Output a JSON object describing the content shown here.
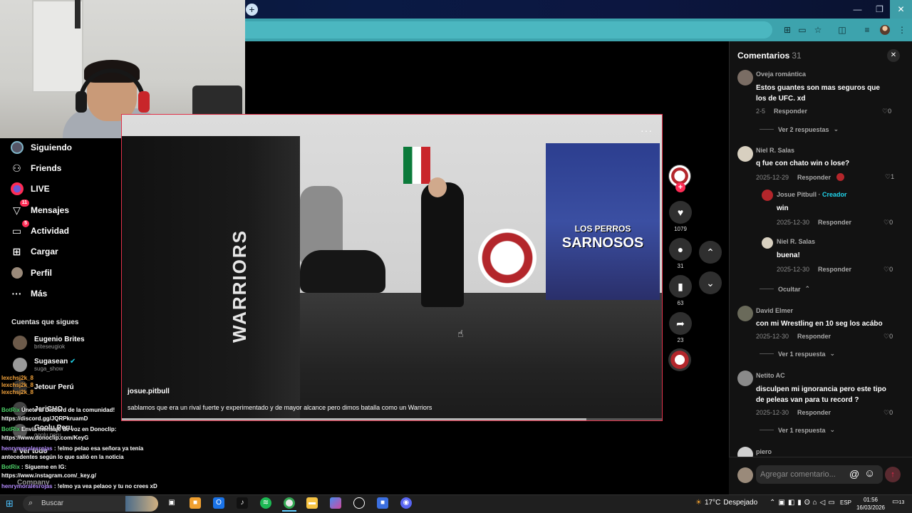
{
  "browser": {
    "new_tab": "+",
    "window_buttons": [
      "—",
      "❐",
      "✕"
    ],
    "toolbar_icons": [
      "translate-icon",
      "cast-icon",
      "star-icon",
      "extensions-icon",
      "playlist-icon",
      "menu-icon"
    ]
  },
  "nav": {
    "items": [
      {
        "label": "Siguiendo",
        "icon": "following-icon"
      },
      {
        "label": "Friends",
        "icon": "friends-icon",
        "glyph": "👥"
      },
      {
        "label": "LIVE",
        "icon": "live-icon",
        "glyph": "●"
      },
      {
        "label": "Mensajes",
        "icon": "messages-icon",
        "glyph": "▽",
        "badge": "11"
      },
      {
        "label": "Actividad",
        "icon": "activity-icon",
        "glyph": "▭",
        "badge": "5"
      },
      {
        "label": "Cargar",
        "icon": "upload-icon",
        "glyph": "⊞"
      },
      {
        "label": "Perfil",
        "icon": "profile-icon",
        "glyph": "●"
      },
      {
        "label": "Más",
        "icon": "more-icon",
        "glyph": "···"
      }
    ],
    "following_header": "Cuentas que sigues",
    "accounts": [
      {
        "name": "Eugenio Brites",
        "handle": "briteseugiok"
      },
      {
        "name": "Sugasean",
        "handle": "suga_show"
      },
      {
        "name": "Jetour Perú",
        "handle": ""
      },
      {
        "name": "JeriCHO",
        "handle": ""
      },
      {
        "name": "Goolu Peru",
        "handle": "goolu.peru"
      }
    ],
    "see_all": "Ver todo",
    "company": "Company"
  },
  "chat": [
    {
      "user": "lexchsj2k_8",
      "text": ""
    },
    {
      "user": "lexchsj2k_8",
      "text": ""
    },
    {
      "user": "lexchsj2k_8",
      "text": ""
    },
    {
      "user": "BotRix",
      "text": "Únete al Discord de la comunidad!"
    },
    {
      "user": "",
      "text": "https://discord.gg/JQRPkruamD"
    },
    {
      "user": "BotRix",
      "text": "Envía mensaje de voz en Donoclip:"
    },
    {
      "user": "",
      "text": "https://www.donoclip.com/KeyG"
    },
    {
      "user": "henrymoralesrojas",
      "text": ": !elmo pelao esa señora ya tenía"
    },
    {
      "user": "",
      "text": "antecedentes según lo que salió en la noticia"
    },
    {
      "user": "BotRix",
      "text": ": Sígueme en IG:"
    },
    {
      "user": "",
      "text": "https://www.instagram.com/_key.g/"
    },
    {
      "user": "henrymoralesrojas",
      "text": ": !elmo ya vea pelaoo y tu no crees xD"
    }
  ],
  "video": {
    "username": "josue.pitbull",
    "caption": "sablamos que era un rival fuerte y experimentado y de mayor alcance pero dimos batalla como un Warriors",
    "more": "···",
    "wall_text_1": "LOS PERROS",
    "wall_text_2": "SARNOSOS",
    "cage_text": "WARRIORS",
    "progress": 0.86
  },
  "actions": {
    "likes": "1079",
    "comments": "31",
    "saves": "63",
    "shares": "23",
    "like_icon": "♥",
    "comment_icon": "💬",
    "save_icon": "🔖",
    "share_icon": "➦",
    "up": "⌃",
    "down": "⌄",
    "follow": "+"
  },
  "comments": {
    "title": "Comentarios",
    "count": "31",
    "close": "✕",
    "items": [
      {
        "user": "Oveja romántica",
        "text": "Estos guantes son mas seguros que los de UFC. xd",
        "date": "2-5",
        "reply": "Responder",
        "likes": "0",
        "view": "Ver 2 respuestas"
      },
      {
        "user": "Niel R. Salas",
        "text": "q fue con chato win o lose?",
        "date": "2025-12-29",
        "reply": "Responder",
        "likes": "1"
      },
      {
        "user": "Josue Pitbull",
        "creator": "Creador",
        "text": "win",
        "date": "2025-12-30",
        "reply": "Responder",
        "likes": "0"
      },
      {
        "user": "Niel R. Salas",
        "text": "buena!",
        "date": "2025-12-30",
        "reply": "Responder",
        "likes": "0",
        "view": "Ocultar"
      },
      {
        "user": "David Elmer",
        "text": "con mi Wrestling en 10 seg los acábo",
        "date": "2025-12-30",
        "reply": "Responder",
        "likes": "0",
        "view": "Ver 1 respuesta"
      },
      {
        "user": "Netito AC",
        "text": "disculpen mi ignorancia pero este tipo de peleas van para tu record ?",
        "date": "2025-12-30",
        "reply": "Responder",
        "likes": "0",
        "view": "Ver 1 respuesta"
      },
      {
        "user": "piero",
        "text": ""
      }
    ],
    "input_placeholder": "Agregar comentario...",
    "at": "@",
    "emoji": "☺",
    "send": "↑"
  },
  "taskbar": {
    "search": "Buscar",
    "weather_temp": "17°C",
    "weather_desc": "Despejado",
    "lang": "ESP",
    "time": "01:56",
    "date": "16/03/2026",
    "notifications": "13"
  }
}
